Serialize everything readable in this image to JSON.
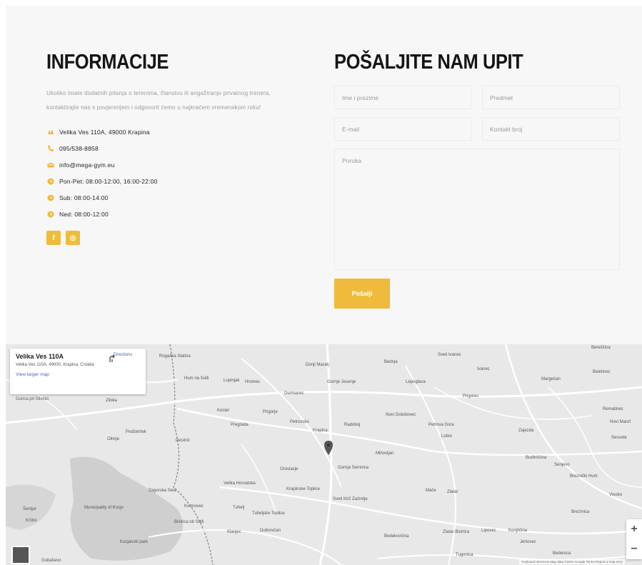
{
  "info": {
    "heading": "INFORMACIJE",
    "intro": "Ukoliko imate dodatnih pitanja o terenima, članstvu ili angažiranju privatnog trenera, kontaktirajte nas s povjerenjem i odgovorit ćemo u najkraćem vremenskom roku!",
    "contacts": [
      {
        "icon": "map-icon",
        "text": "Velika Ves 110A, 49000 Krapina"
      },
      {
        "icon": "phone-icon",
        "text": "095/538-8858"
      },
      {
        "icon": "mail-icon",
        "text": "info@mega-gym.eu"
      },
      {
        "icon": "clock-icon",
        "text": "Pon-Pet: 08:00-12:00, 16:00-22:00"
      },
      {
        "icon": "clock-icon",
        "text": "Sub: 08:00-14:00"
      },
      {
        "icon": "clock-icon",
        "text": "Ned: 08:00-12:00"
      }
    ],
    "socials": [
      {
        "icon": "facebook-icon",
        "glyph": "f"
      },
      {
        "icon": "instagram-icon",
        "glyph": "◎"
      }
    ]
  },
  "form": {
    "heading": "POŠALJITE NAM UPIT",
    "name_placeholder": "Ime i prezime",
    "subject_placeholder": "Predmet",
    "email_placeholder": "E-mail",
    "phone_placeholder": "Kontakt broj",
    "message_placeholder": "Poruka",
    "submit_label": "Pošalji"
  },
  "map": {
    "place_title": "Velika Ves 110A",
    "place_address": "Velika Ves 110A, 49000, Krapina, Croatia",
    "directions_label": "Directions",
    "larger_map_label": "View larger map",
    "zoom_in": "+",
    "zoom_out": "−",
    "attribution": "Keyboard shortcuts   Map data ©2024 Google   Terms   Report a map error",
    "labels": [
      "Rogaška Slatina",
      "Donji Macelj",
      "Bednja",
      "Sveti Ivanec",
      "Ivanec",
      "Beletinec",
      "Hum na Sutli",
      "Lupinjak",
      "Hromec",
      "Gornje Jesenje",
      "Lepoglava",
      "Margečan",
      "Gorica pri Slivnici",
      "Zibika",
      "Durmanec",
      "Prigorec",
      "Kostel",
      "Prigorje",
      "Petrovsko",
      "Radoboj",
      "Novi Golubovec",
      "Petrova Gora",
      "Zajezda",
      "Podčetrtek",
      "Olimje",
      "Pregrada",
      "Krapina",
      "Lobor",
      "Mihovljan",
      "Budinščina",
      "Desinić",
      "Gornja Semnica",
      "Oroslavje",
      "Velika Horvatska",
      "Mače",
      "Zlatar",
      "Zagorska Sela",
      "Krapinske Toplice",
      "Sveti Križ Začretje",
      "Municipality of Kozje",
      "Kumrovec",
      "Tuhelj",
      "Tuheljske Toplice",
      "Bistrica ob Sotli",
      "Klanjec",
      "Dubrovčan",
      "Bedekovčina",
      "Zlatar-Bistrica",
      "Lipovec",
      "Konjščina",
      "Jertovec",
      "Bedenica",
      "Brezrnica",
      "Kozjanski park",
      "Tugonica",
      "Gubaševo",
      "Šentjur",
      "Kršbo",
      "Bereščina",
      "Breznički Hum",
      "Visoko",
      "Novi Marof",
      "Rematinec",
      "Sesvete",
      "Senjevo"
    ]
  }
}
